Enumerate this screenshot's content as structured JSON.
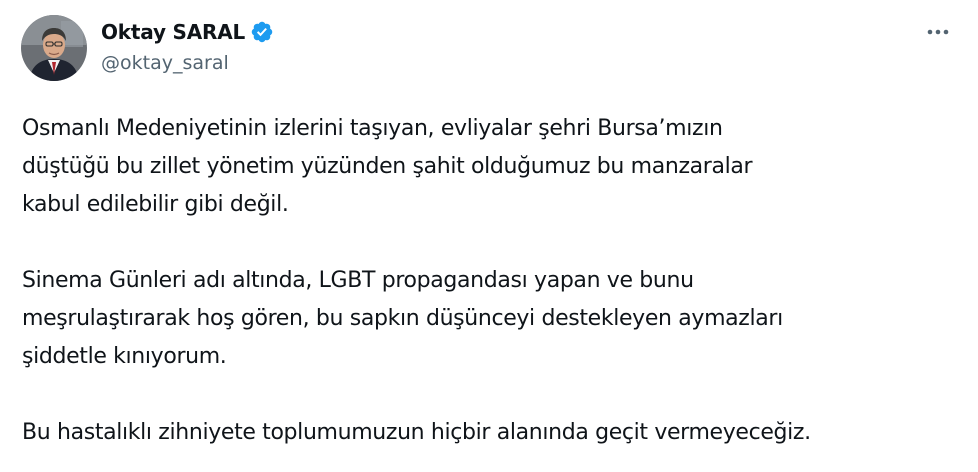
{
  "author": {
    "display_name": "Oktay SARAL",
    "handle": "@oktay_saral",
    "verified": true,
    "verified_color": "#1d9bf0"
  },
  "menu": {
    "more_icon": "more-horizontal-icon"
  },
  "tweet": {
    "paragraphs": [
      "Osmanlı Medeniyetinin izlerini taşıyan, evliyalar şehri Bursa’mızın\ndüştüğü bu zillet yönetim yüzünden şahit olduğumuz bu manzaralar\nkabul edilebilir gibi değil.",
      "Sinema Günleri adı altında, LGBT propagandası yapan ve bunu\nmeşrulaştırarak hoş gören, bu sapkın düşünceyi destekleyen aymazları\nşiddetle kınıyorum.",
      "Bu hastalıklı zihniyete toplumumuzun hiçbir alanında geçit vermeyeceğiz."
    ]
  },
  "colors": {
    "text": "#0f1419",
    "secondary": "#536471",
    "accent": "#1d9bf0"
  }
}
